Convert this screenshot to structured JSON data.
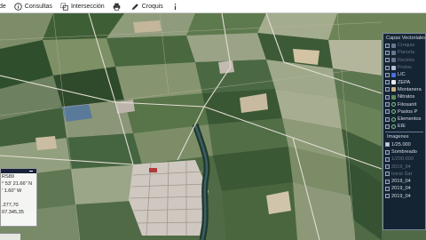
{
  "toolbar": {
    "items": [
      {
        "label": "de",
        "icon": "truncated-icon"
      },
      {
        "label": "Consultas",
        "icon": "info-circle-icon"
      },
      {
        "label": "Intersección",
        "icon": "intersection-icon"
      },
      {
        "label": "",
        "icon": "print-icon"
      },
      {
        "label": "Croquis",
        "icon": "pencil-icon"
      },
      {
        "label": "",
        "icon": "info-icon"
      }
    ]
  },
  "layers": {
    "title": "Capas Vectoriales",
    "items": [
      {
        "label": "Croquis",
        "swatch": "#6c768b",
        "dim": true
      },
      {
        "label": "Parcela",
        "swatch": "#6c768b",
        "dim": true
      },
      {
        "label": "Recinto",
        "swatch": "#6c768b",
        "dim": true
      },
      {
        "label": "Frutos",
        "swatch": "#b3bed4",
        "dim": true
      },
      {
        "label": "LIC",
        "swatch": "#4a6fe0",
        "dim": false
      },
      {
        "label": "ZEPA",
        "swatch": "#e9e9e9",
        "dim": false
      },
      {
        "label": "Montanera",
        "swatch": "#c9b27a",
        "dim": false
      },
      {
        "label": "Nitratos",
        "swatch": "#5f8c5a",
        "dim": false
      },
      {
        "label": "Fitosanit",
        "ring": true,
        "dim": false
      },
      {
        "label": "Pastos P",
        "ring": true,
        "dim": false
      },
      {
        "label": "Elementos",
        "ring": true,
        "dim": false
      },
      {
        "label": "EIE",
        "ring": true,
        "dim": false
      }
    ],
    "images_title": "Imagenes",
    "images": [
      {
        "label": "1/25.000",
        "checked": true,
        "dim": false
      },
      {
        "label": "Sombreado",
        "checked": false,
        "dim": false
      },
      {
        "label": "1/200.000",
        "checked": false,
        "dim": true
      },
      {
        "label": "2019_04",
        "checked": false,
        "dim": true
      },
      {
        "label": "Inicio Sat",
        "checked": false,
        "dim": true
      },
      {
        "label": "2019_04",
        "checked": false,
        "dim": false
      },
      {
        "label": "2019_04",
        "checked": false,
        "dim": false
      },
      {
        "label": "2019_04",
        "checked": false,
        "dim": false
      }
    ]
  },
  "coords": {
    "lines": [
      "RS89",
      "° 53' 21.66\" N",
      "' 1.60\" W",
      "",
      ".277,70",
      "07.345,35"
    ]
  }
}
